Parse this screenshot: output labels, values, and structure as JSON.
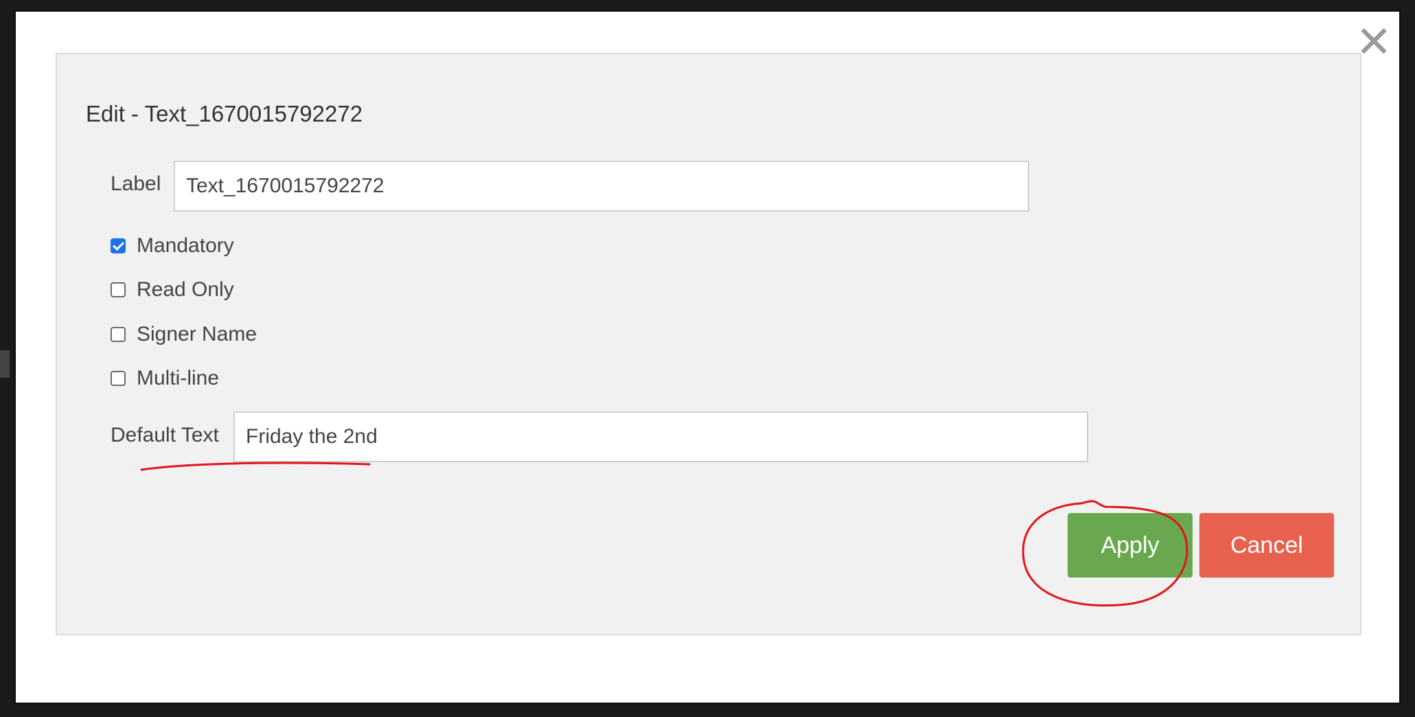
{
  "modal": {
    "title": "Edit - Text_1670015792272",
    "close_label": "✕",
    "fields": {
      "label": {
        "label": "Label",
        "value": "Text_1670015792272"
      },
      "default_text": {
        "label": "Default Text",
        "value": "Friday the 2nd"
      }
    },
    "checkboxes": [
      {
        "label": "Mandatory",
        "checked": true
      },
      {
        "label": "Read Only",
        "checked": false
      },
      {
        "label": "Signer Name",
        "checked": false
      },
      {
        "label": "Multi-line",
        "checked": false
      }
    ],
    "buttons": {
      "apply": "Apply",
      "cancel": "Cancel"
    }
  },
  "colors": {
    "apply": "#6aa84f",
    "cancel": "#e8604e",
    "checkbox_checked": "#1a73e8",
    "annotation": "#e3131b"
  }
}
